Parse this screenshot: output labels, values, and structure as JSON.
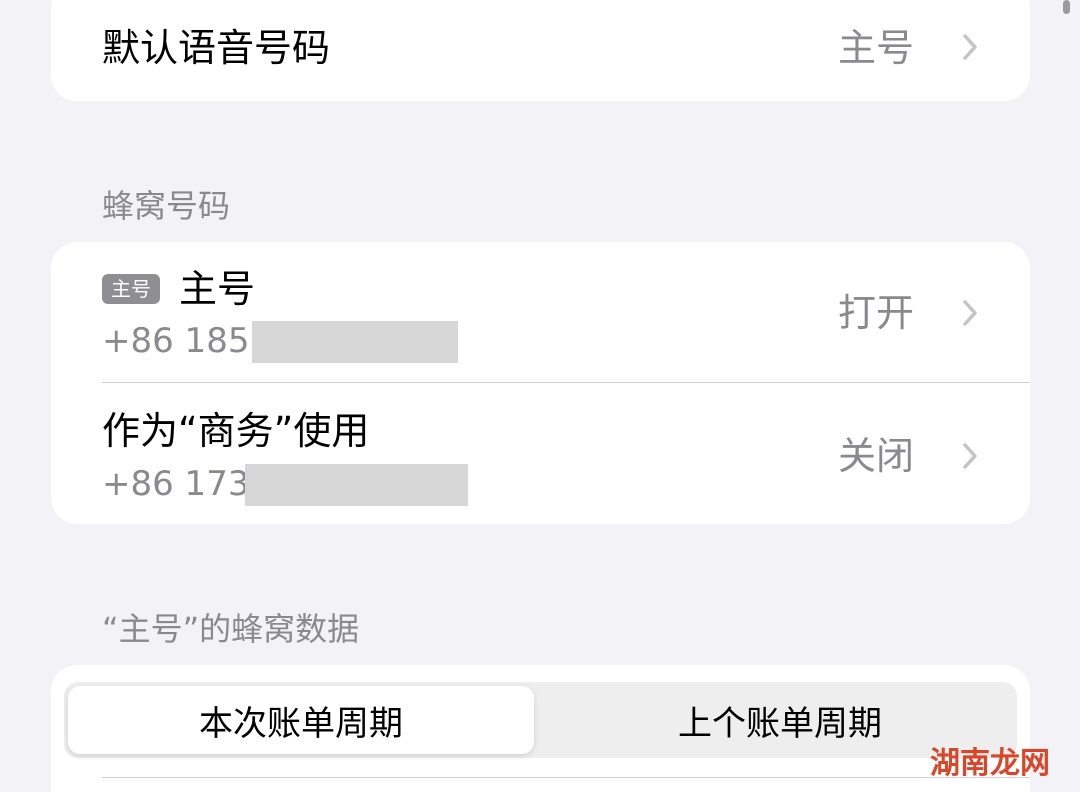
{
  "default_voice": {
    "title": "默认语音号码",
    "value": "主号"
  },
  "cellular_numbers": {
    "header": "蜂窝号码",
    "lines": [
      {
        "badge": "主号",
        "title": "主号",
        "number": "+86 185",
        "status": "打开"
      },
      {
        "title": "作为“商务”使用",
        "number": "+86 173",
        "status": "关闭"
      }
    ]
  },
  "cellular_data": {
    "header": "“主号”的蜂窝数据",
    "segments": [
      "本次账单周期",
      "上个账单周期"
    ],
    "selected_segment": "本次账单周期"
  },
  "watermark": "湖南龙网",
  "colors": {
    "background": "#f2f2f7",
    "card": "#ffffff",
    "secondary_text": "#8a8a8e",
    "badge": "#8e8e93",
    "watermark": "#d9472b"
  },
  "icons": [
    "chevron-right-icon"
  ]
}
